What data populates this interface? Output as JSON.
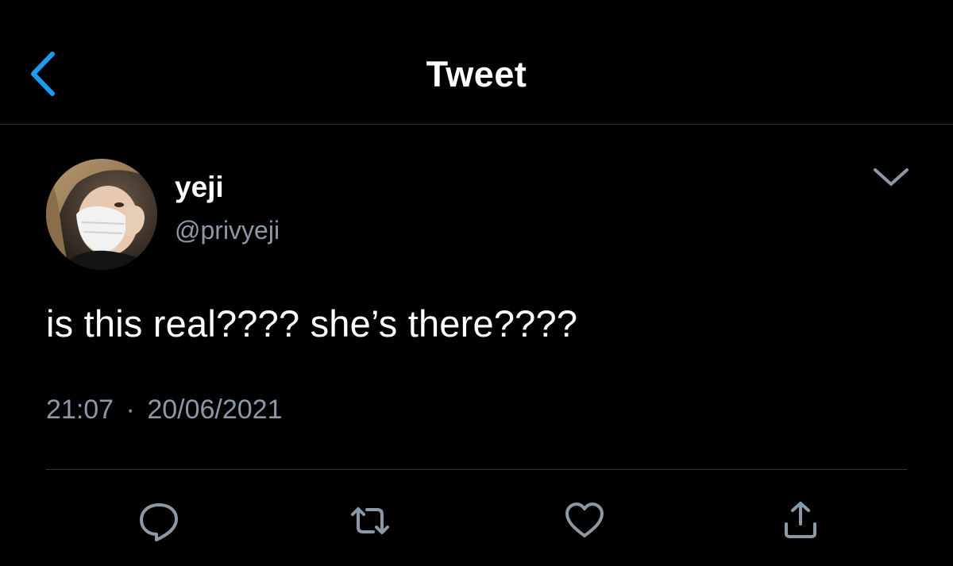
{
  "header": {
    "title": "Tweet",
    "back_icon": "chevron-left-icon"
  },
  "tweet": {
    "author": {
      "display_name": "yeji",
      "handle": "@privyeji"
    },
    "text": "is this real???? she’s there????",
    "time": "21:07",
    "separator": "·",
    "date": "20/06/2021",
    "menu_icon": "chevron-down-icon"
  },
  "actions": [
    {
      "icon": "reply-icon"
    },
    {
      "icon": "retweet-icon"
    },
    {
      "icon": "like-icon"
    },
    {
      "icon": "share-icon"
    }
  ],
  "colors": {
    "background": "#000000",
    "accent": "#1d9bf0",
    "secondary_text": "#8b98a5",
    "divider": "#2f3336"
  }
}
